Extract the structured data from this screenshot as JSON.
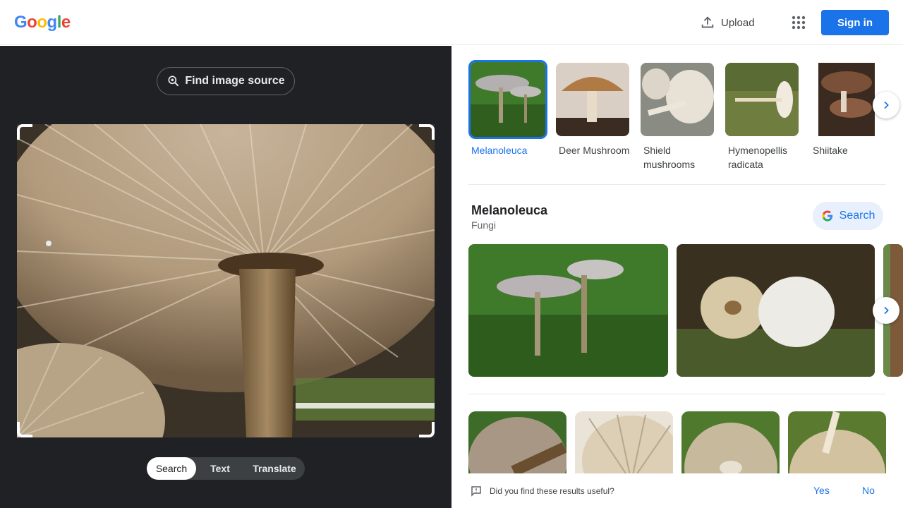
{
  "header": {
    "logo_letters": [
      {
        "char": "G",
        "color": "#4285F4"
      },
      {
        "char": "o",
        "color": "#EA4335"
      },
      {
        "char": "o",
        "color": "#FBBC05"
      },
      {
        "char": "g",
        "color": "#4285F4"
      },
      {
        "char": "l",
        "color": "#34A853"
      },
      {
        "char": "e",
        "color": "#EA4335"
      }
    ],
    "upload_label": "Upload",
    "signin_label": "Sign in"
  },
  "left": {
    "find_source_label": "Find image source",
    "modes": [
      "Search",
      "Text",
      "Translate"
    ],
    "active_mode": "Search"
  },
  "related": [
    {
      "label": "Melanoleuca",
      "selected": true
    },
    {
      "label": "Deer Mushroom",
      "selected": false
    },
    {
      "label": "Shield mushrooms",
      "selected": false
    },
    {
      "label": "Hymenopellis radicata",
      "selected": false
    },
    {
      "label": "Shiitake",
      "selected": false
    }
  ],
  "entity": {
    "title": "Melanoleuca",
    "subtitle": "Fungi",
    "search_label": "Search"
  },
  "feedback": {
    "question": "Did you find these results useful?",
    "yes": "Yes",
    "no": "No"
  },
  "colors": {
    "accent": "#1a73e8",
    "dark_bg": "#202124"
  }
}
